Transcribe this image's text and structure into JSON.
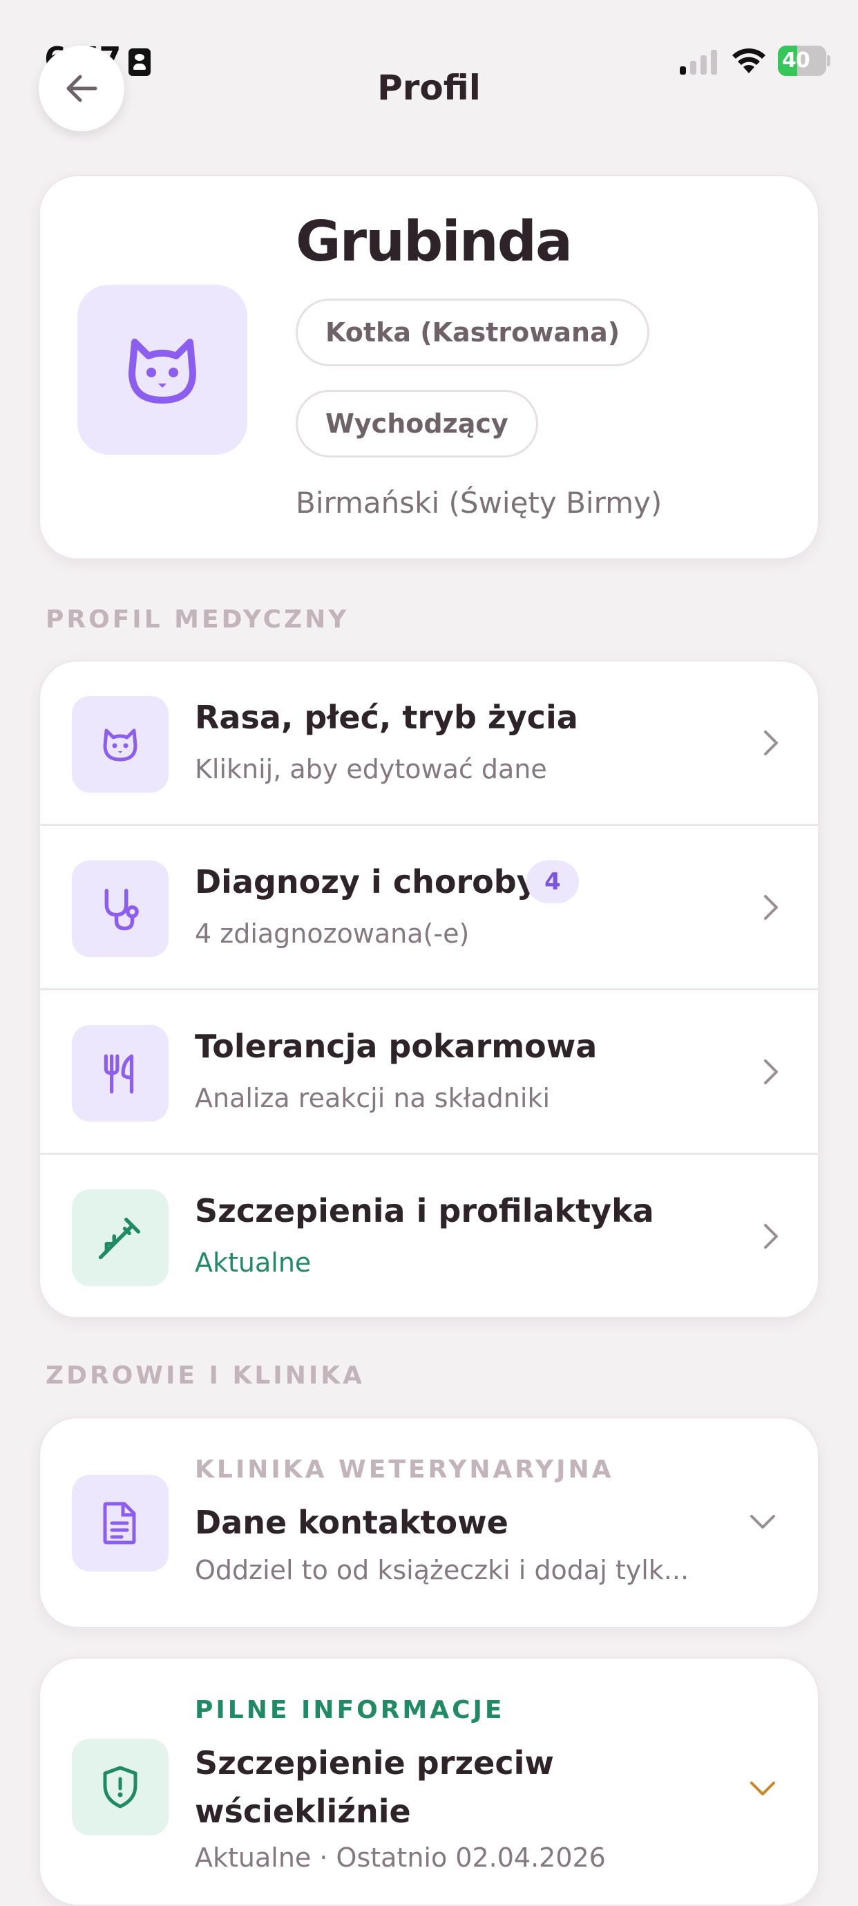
{
  "status_bar": {
    "time": "6:57",
    "battery": "40",
    "battery_level": 0.4
  },
  "header": {
    "title": "Profil"
  },
  "pet": {
    "name": "Grubinda",
    "chips": [
      "Kotka (Kastrowana)",
      "Wychodzący"
    ],
    "breed": "Birmański (Święty Birmy)"
  },
  "sections": {
    "medical": "PROFIL MEDYCZNY",
    "health": "ZDROWIE I KLINIKA"
  },
  "medical_rows": [
    {
      "icon": "cat-icon",
      "title": "Rasa, płeć, tryb życia",
      "subtitle": "Kliknij, aby edytować dane"
    },
    {
      "icon": "stethoscope-icon",
      "title": "Diagnozy i choroby",
      "badge": "4",
      "subtitle": "4 zdiagnozowana(-e)"
    },
    {
      "icon": "fork-knife-icon",
      "title": "Tolerancja pokarmowa",
      "subtitle": "Analiza reakcji na składniki"
    },
    {
      "icon": "syringe-icon",
      "title": "Szczepienia i profilaktyka",
      "subtitle": "Aktualne"
    }
  ],
  "clinic": {
    "eyebrow": "KLINIKA WETERYNARYJNA",
    "title": "Dane kontaktowe",
    "subtitle": "Oddziel to od książeczki i dodaj tylk..."
  },
  "urgent": {
    "eyebrow": "PILNE INFORMACJE",
    "title_line1": "Szczepienie przeciw",
    "title_line2": "wściekliźnie",
    "subtitle": "Aktualne · Ostatnio 02.04.2026"
  },
  "colors": {
    "accent_purple": "#7b55e0",
    "accent_green": "#1f8a64",
    "chevron_orange": "#c9892a",
    "background": "#f4f1f3"
  }
}
